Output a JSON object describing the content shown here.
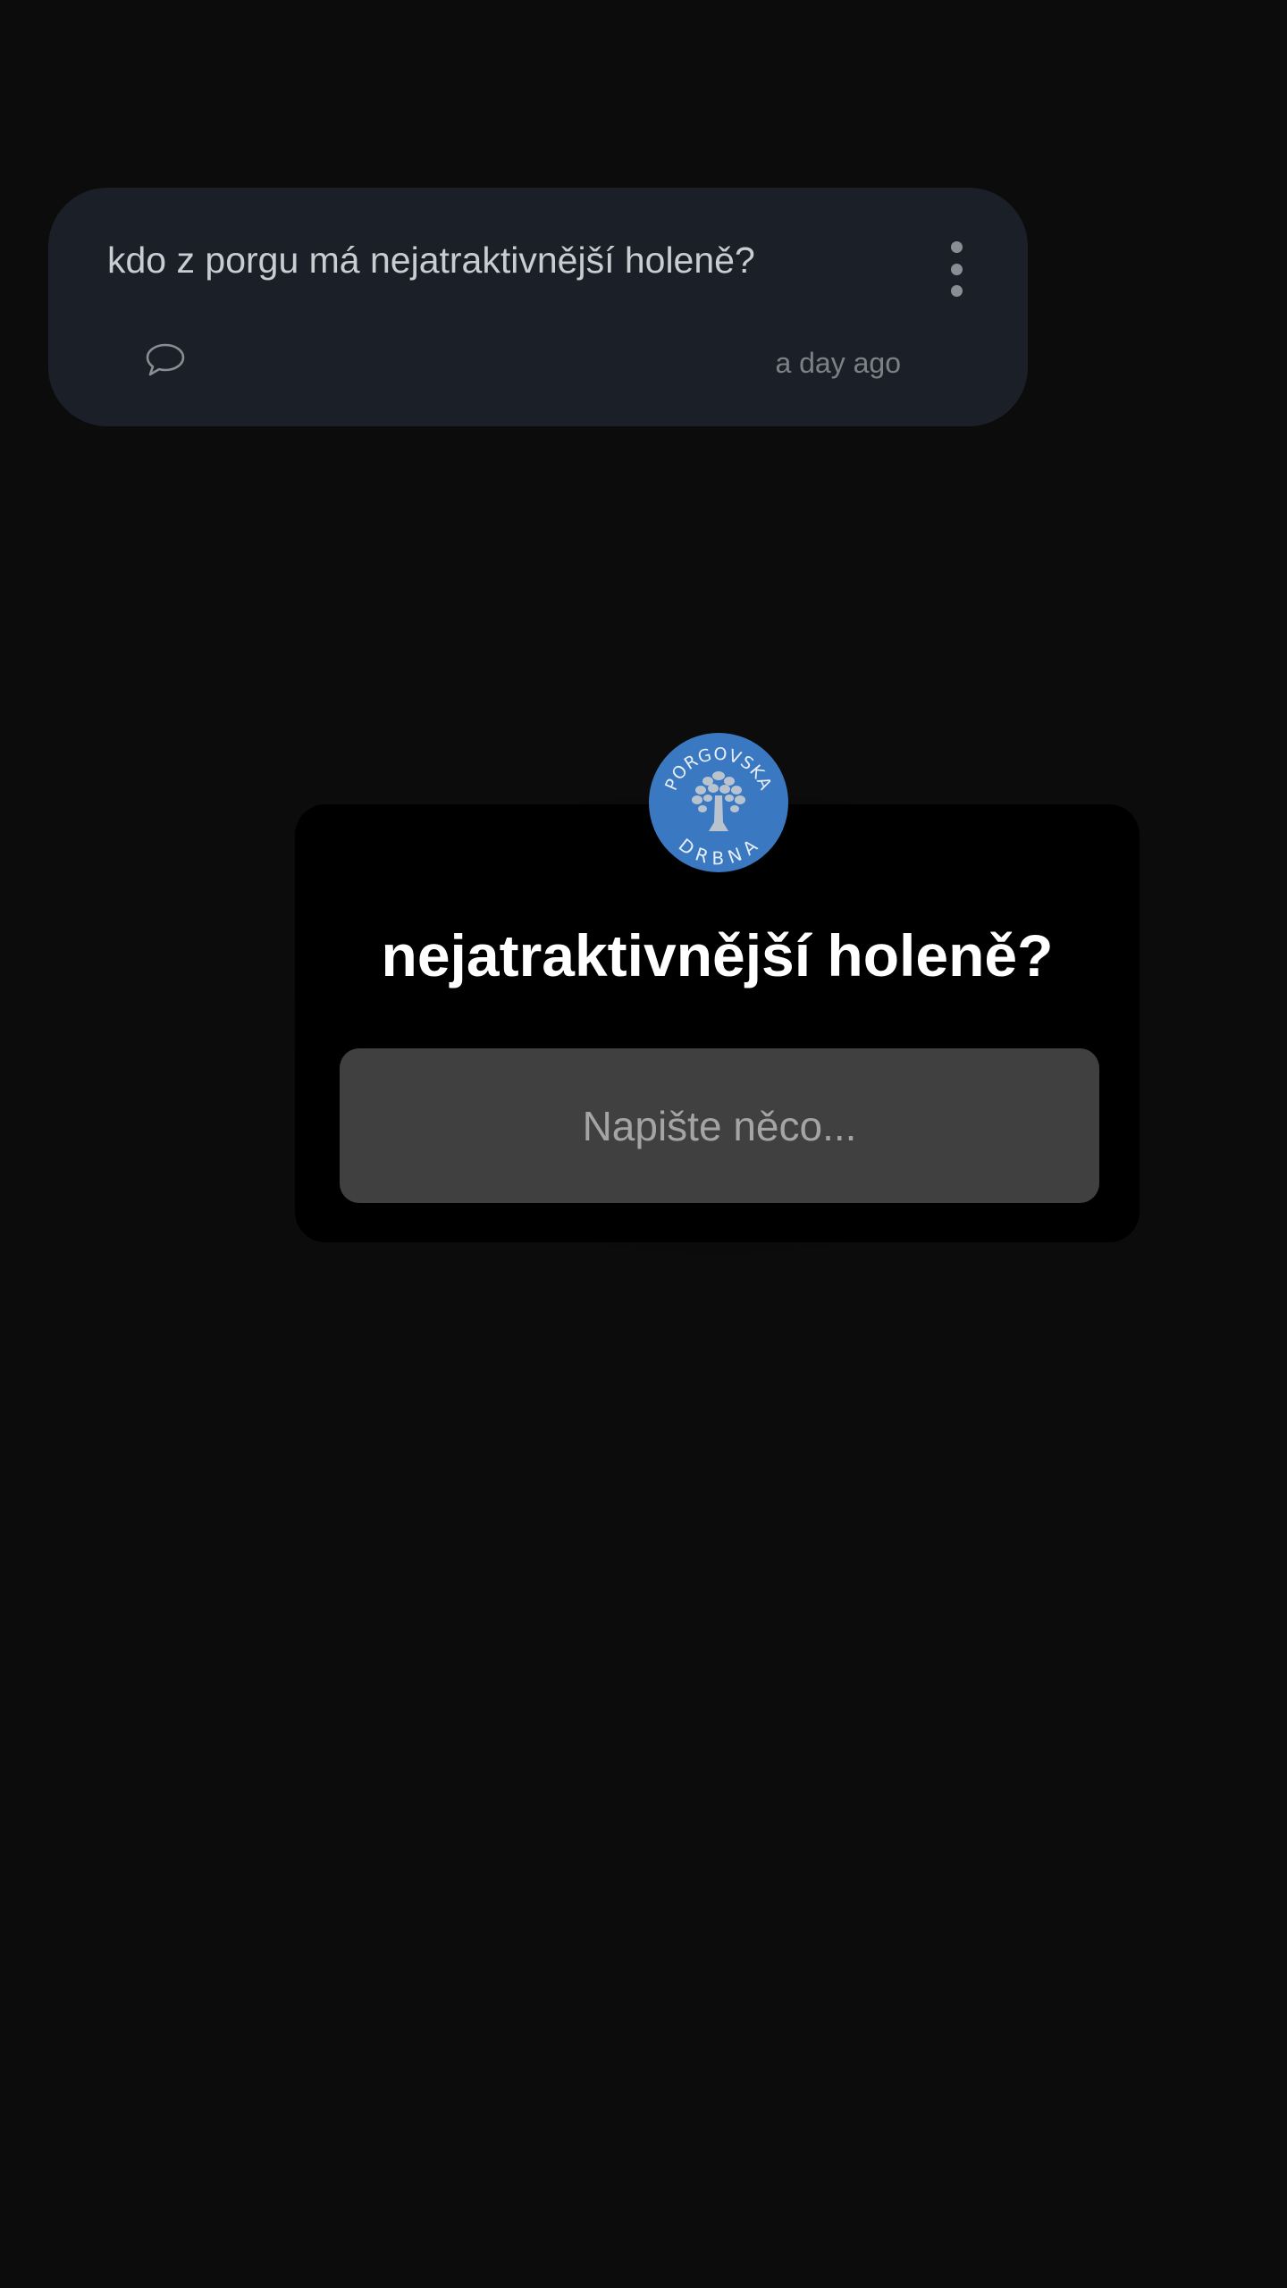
{
  "post": {
    "text": "kdo z porgu má nejatraktivnější holeně?",
    "time": "a day ago",
    "icons": {
      "more": "more-vertical-icon",
      "comment": "comment-bubble-icon"
    }
  },
  "modal": {
    "title": "nejatraktivnější holeně?",
    "input_placeholder": "Napište něco...",
    "input_value": "",
    "avatar": {
      "logo_text_top": "PORGOVSKA",
      "logo_text_bottom": "DRBNA",
      "color": "#3a79c1",
      "icon": "tree-logo-icon"
    }
  },
  "colors": {
    "background": "#0c0c0c",
    "card": "#1b2028",
    "modal": "#000000",
    "input": "#404040",
    "accent": "#3a79c1"
  }
}
